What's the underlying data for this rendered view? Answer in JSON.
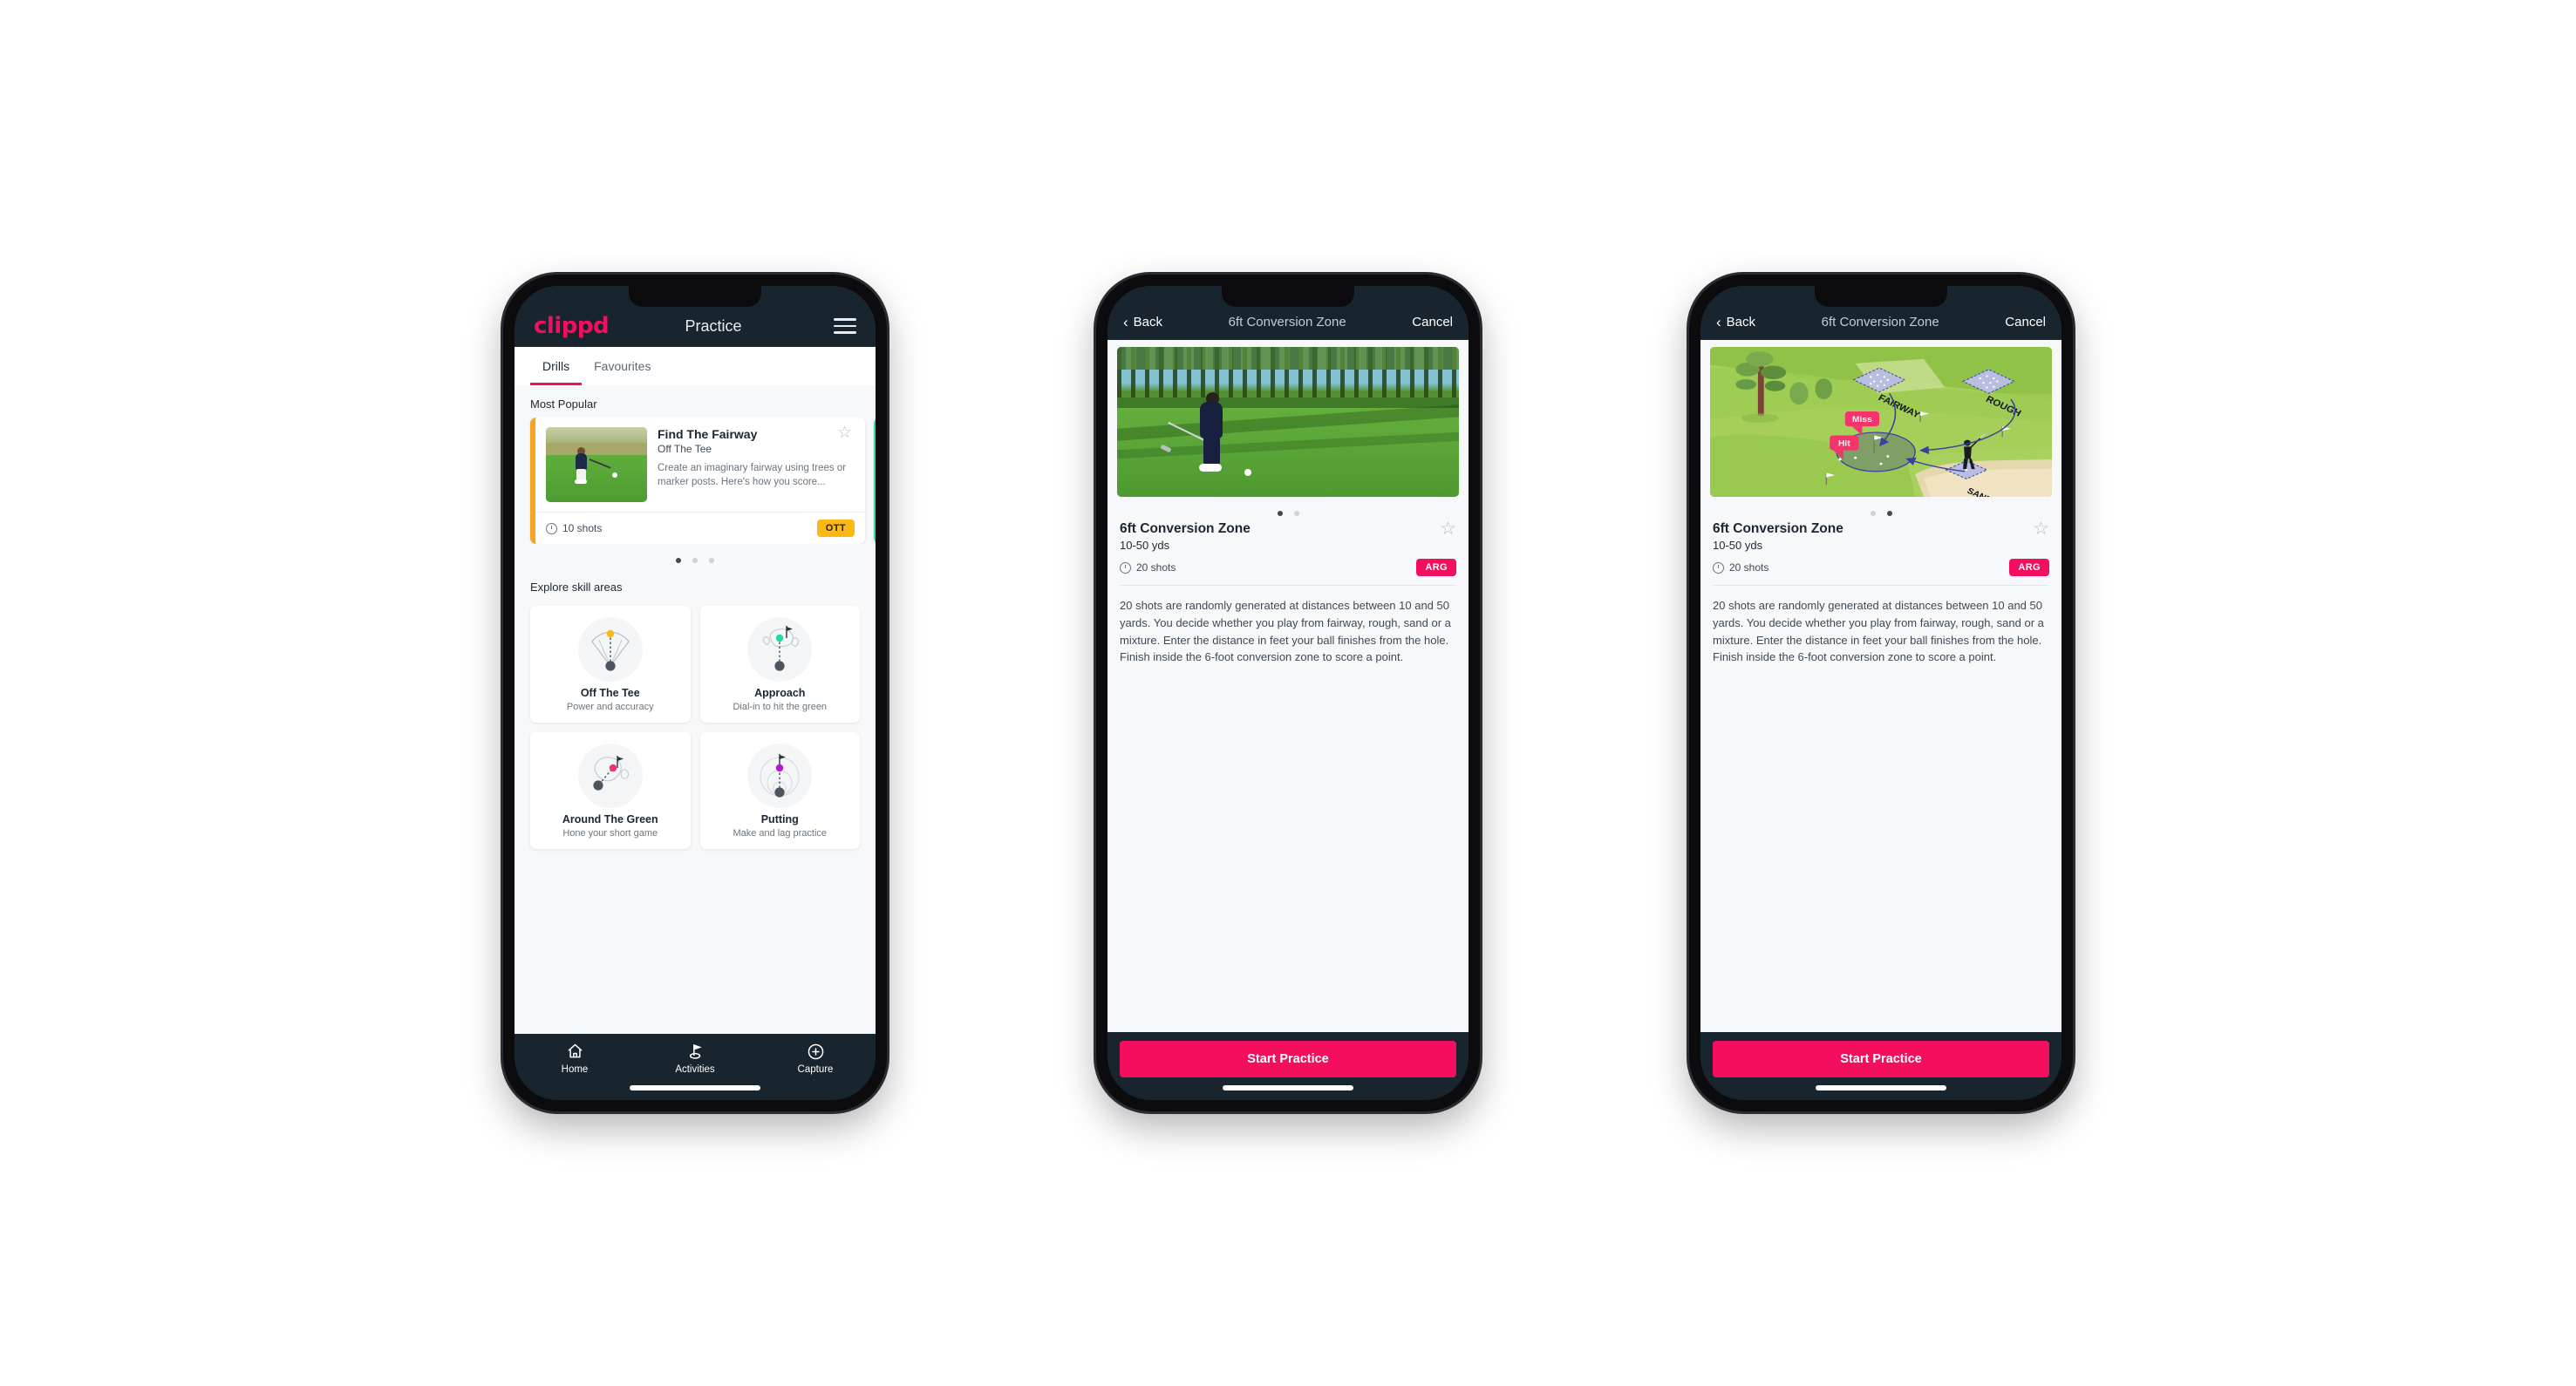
{
  "app": {
    "brand": "clippd",
    "accent_pink": "#f40f5e",
    "dark_navy": "#18252f",
    "amber": "#fbb713",
    "teal": "#3ad6b0"
  },
  "phone_practice": {
    "header": {
      "logo": "clippd",
      "title": "Practice",
      "menu_icon": "hamburger-menu-icon"
    },
    "tabs": [
      {
        "label": "Drills",
        "active": true
      },
      {
        "label": "Favourites",
        "active": false
      }
    ],
    "most_popular": {
      "section_label": "Most Popular",
      "card": {
        "title": "Find The Fairway",
        "subtitle": "Off The Tee",
        "description": "Create an imaginary fairway using trees or marker posts. Here's how you score...",
        "shots": "10 shots",
        "badge": "OTT",
        "badge_color": "#fbb713",
        "accent_color": "#f5a623",
        "star_icon": "star-outline-icon",
        "clock_icon": "clock-icon",
        "thumbnail": "golfer-teeing-off-photo"
      },
      "pager": {
        "count": 3,
        "active_index": 0
      }
    },
    "skill_areas": {
      "section_label": "Explore skill areas",
      "items": [
        {
          "name": "Off The Tee",
          "desc": "Power and accuracy",
          "icon": "tee-shot-cone-icon",
          "dot_color": "#fbb713"
        },
        {
          "name": "Approach",
          "desc": "Dial-in to hit the green",
          "icon": "approach-green-icon",
          "dot_color": "#1fd9a8"
        },
        {
          "name": "Around The Green",
          "desc": "Hone your short game",
          "icon": "around-the-green-icon",
          "dot_color": "#f4356b"
        },
        {
          "name": "Putting",
          "desc": "Make and lag practice",
          "icon": "putting-rings-icon",
          "dot_color": "#b21ad6"
        }
      ]
    },
    "bottom_nav": [
      {
        "label": "Home",
        "icon": "home-icon",
        "active": false
      },
      {
        "label": "Activities",
        "icon": "golf-flag-icon",
        "active": true
      },
      {
        "label": "Capture",
        "icon": "plus-circle-icon",
        "active": false
      }
    ]
  },
  "phone_detail_photo": {
    "nav": {
      "back_label": "Back",
      "back_icon": "chevron-left-icon",
      "title": "6ft Conversion Zone",
      "cancel_label": "Cancel"
    },
    "media": {
      "type": "photo",
      "alt": "golfer-chipping-onto-green-photo"
    },
    "pager": {
      "count": 2,
      "active_index": 0
    },
    "drill": {
      "title": "6ft Conversion Zone",
      "distance": "10-50 yds",
      "shots": "20 shots",
      "badge": "ARG",
      "badge_color": "#f40f5e",
      "star_icon": "star-outline-icon",
      "clock_icon": "clock-icon",
      "description": "20 shots are randomly generated at distances between 10 and 50 yards. You decide whether you play from fairway, rough, sand or a mixture. Enter the distance in feet your ball finishes from the hole. Finish inside the 6-foot conversion zone to score a point."
    },
    "cta": {
      "label": "Start Practice"
    }
  },
  "phone_detail_illustration": {
    "nav": {
      "back_label": "Back",
      "back_icon": "chevron-left-icon",
      "title": "6ft Conversion Zone",
      "cancel_label": "Cancel"
    },
    "media": {
      "type": "illustration",
      "alt": "golf-hole-diagram-illustration",
      "labels": [
        "FAIRWAY",
        "ROUGH",
        "SAND"
      ],
      "markers": [
        {
          "label": "Miss",
          "color": "#f4356b"
        },
        {
          "label": "Hit",
          "color": "#f4356b"
        }
      ]
    },
    "pager": {
      "count": 2,
      "active_index": 1
    },
    "drill": {
      "title": "6ft Conversion Zone",
      "distance": "10-50 yds",
      "shots": "20 shots",
      "badge": "ARG",
      "badge_color": "#f40f5e",
      "star_icon": "star-outline-icon",
      "clock_icon": "clock-icon",
      "description": "20 shots are randomly generated at distances between 10 and 50 yards. You decide whether you play from fairway, rough, sand or a mixture. Enter the distance in feet your ball finishes from the hole. Finish inside the 6-foot conversion zone to score a point."
    },
    "cta": {
      "label": "Start Practice"
    }
  }
}
